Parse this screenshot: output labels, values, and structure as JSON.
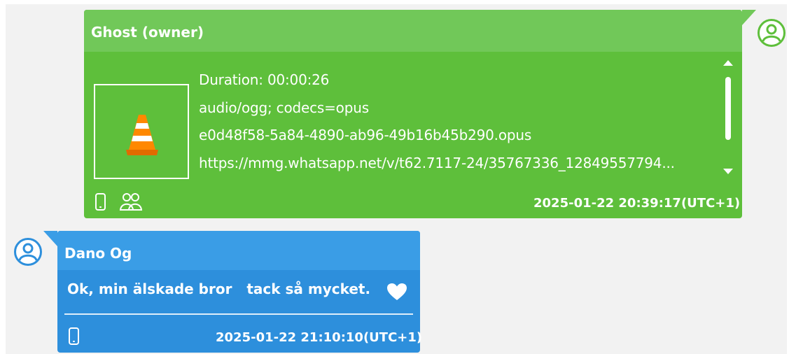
{
  "colors": {
    "outgoing_bubble": "#5ebf3b",
    "outgoing_header": "#71c859",
    "incoming_bubble": "#2d8fdc",
    "incoming_header": "#3a9de6",
    "background": "#f2f2f2"
  },
  "messages": [
    {
      "direction": "outgoing",
      "sender": "Ghost (owner)",
      "attachment": {
        "thumbnail_icon": "vlc-cone-icon",
        "duration": "Duration: 00:00:26",
        "mime": "audio/ogg; codecs=opus",
        "filename": "e0d48f58-5a84-4890-ab96-49b16b45b290.opus",
        "url": "https://mmg.whatsapp.net/v/t62.7117-24/35767336_12849557794..."
      },
      "source_icons": [
        "phone-icon",
        "group-icon"
      ],
      "timestamp": "2025-01-22 20:39:17(UTC+1)",
      "avatar_icon": "user-avatar-icon"
    },
    {
      "direction": "incoming",
      "sender": "Dano Og",
      "text": "Ok, min älskade bror   tack så mycket.",
      "emoji": "white-heart-icon",
      "source_icons": [
        "phone-icon"
      ],
      "timestamp": "2025-01-22 21:10:10(UTC+1)",
      "avatar_icon": "user-avatar-icon"
    }
  ]
}
